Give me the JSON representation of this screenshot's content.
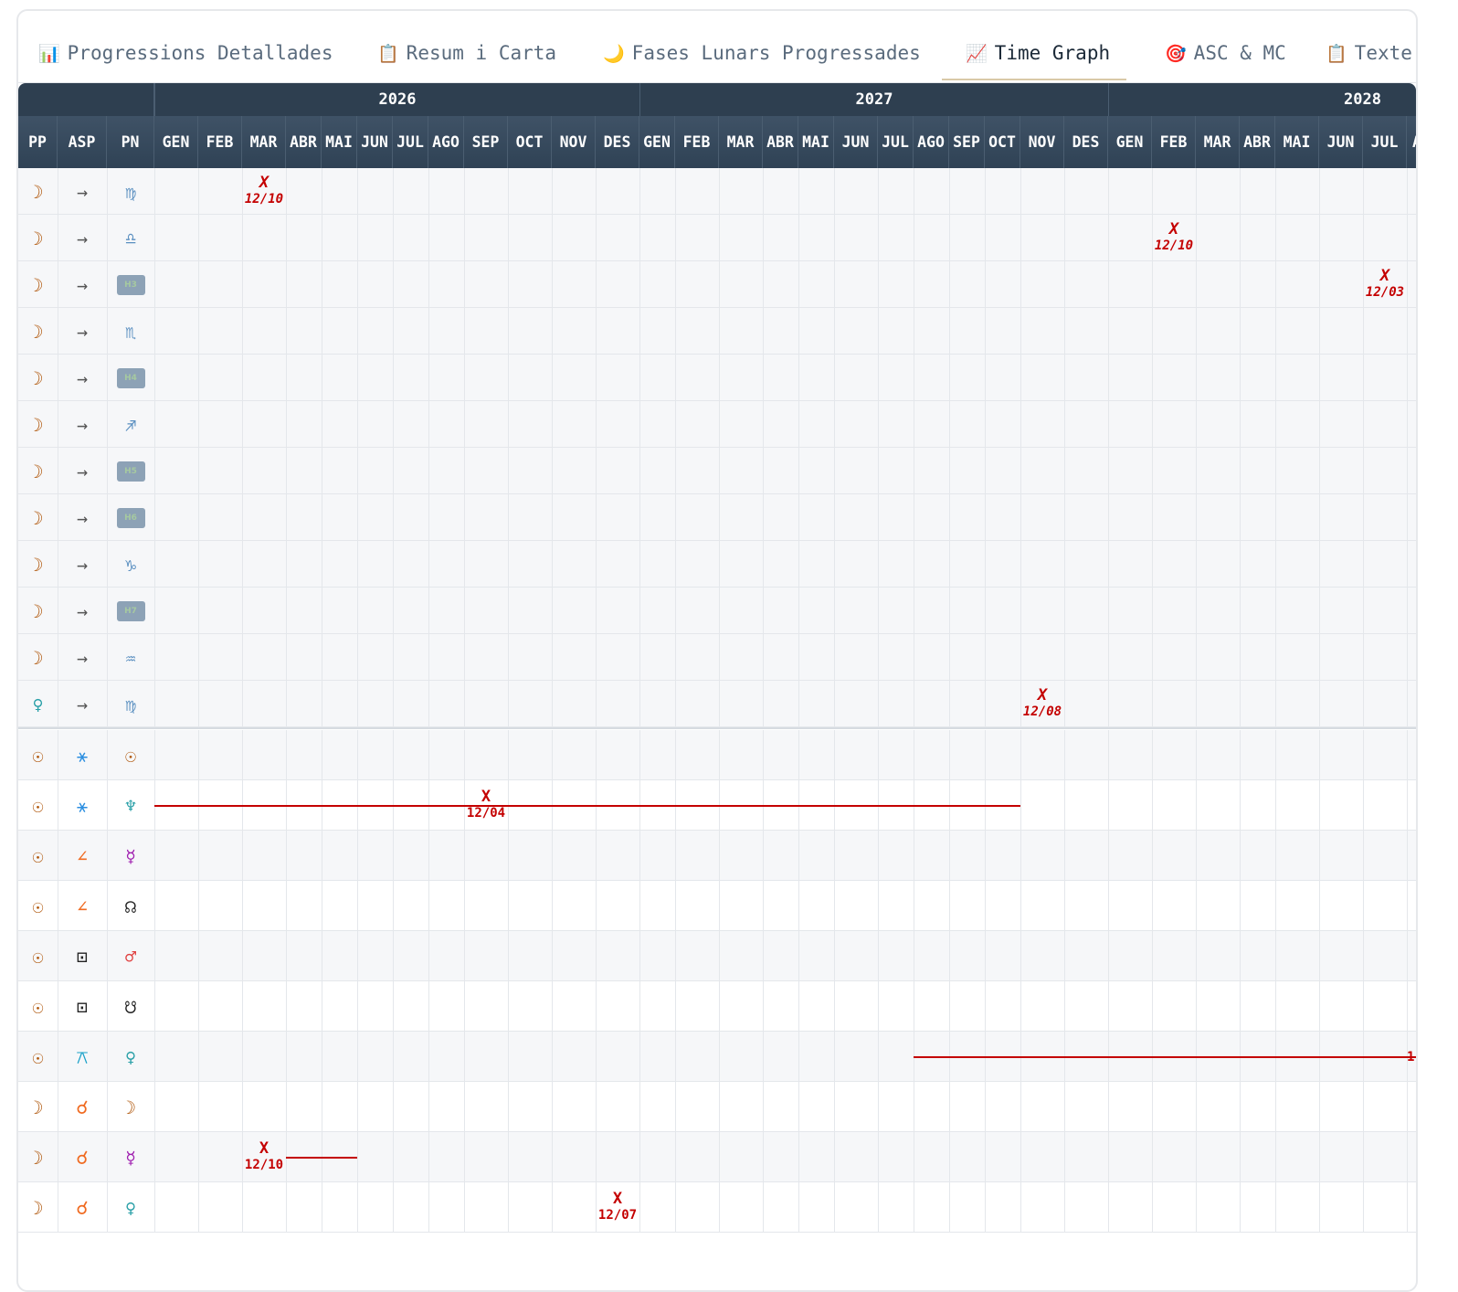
{
  "tabs": [
    {
      "icon": "📊",
      "label": "Progressions Detallades"
    },
    {
      "icon": "📋",
      "label": "Resum i Carta"
    },
    {
      "icon": "🌙",
      "label": "Fases Lunars Progressades"
    },
    {
      "icon": "📈",
      "label": "Time Graph",
      "active": true
    },
    {
      "icon": "🎯",
      "label": "ASC & MC"
    },
    {
      "icon": "📋",
      "label": "Texte"
    }
  ],
  "header": {
    "col_pp": "PP",
    "col_asp": "ASP",
    "col_pn": "PN",
    "years": [
      "2026",
      "2027",
      "2028"
    ],
    "months": [
      "GEN",
      "FEB",
      "MAR",
      "ABR",
      "MAI",
      "JUN",
      "JUL",
      "AGO",
      "SEP",
      "OCT",
      "NOV",
      "DES",
      "GEN",
      "FEB",
      "MAR",
      "ABR",
      "MAI",
      "JUN",
      "JUL",
      "AGO",
      "SEP",
      "OCT",
      "NOV",
      "DES",
      "GEN",
      "FEB",
      "MAR",
      "ABR",
      "MAI",
      "JUN",
      "JUL",
      "A"
    ]
  },
  "ingress_rows": [
    {
      "pp": "☽",
      "pp_color": "#b0570b",
      "asp": "→",
      "pn": "♍",
      "pn_color": "#5a8fc0",
      "marks": [
        {
          "month": 2,
          "x": "X",
          "date": "12/10"
        }
      ]
    },
    {
      "pp": "☽",
      "pp_color": "#b0570b",
      "asp": "→",
      "pn": "♎",
      "pn_color": "#5a8fc0",
      "marks": [
        {
          "month": 25,
          "x": "X",
          "date": "12/10"
        }
      ]
    },
    {
      "pp": "☽",
      "pp_color": "#b0570b",
      "asp": "→",
      "pn": "H3",
      "badge": true,
      "marks": [
        {
          "month": 30,
          "x": "X",
          "date": "12/03"
        }
      ]
    },
    {
      "pp": "☽",
      "pp_color": "#b0570b",
      "asp": "→",
      "pn": "♏",
      "pn_color": "#5a8fc0",
      "marks": []
    },
    {
      "pp": "☽",
      "pp_color": "#b0570b",
      "asp": "→",
      "pn": "H4",
      "badge": true,
      "marks": []
    },
    {
      "pp": "☽",
      "pp_color": "#b0570b",
      "asp": "→",
      "pn": "♐",
      "pn_color": "#5a8fc0",
      "marks": []
    },
    {
      "pp": "☽",
      "pp_color": "#b0570b",
      "asp": "→",
      "pn": "H5",
      "badge": true,
      "marks": []
    },
    {
      "pp": "☽",
      "pp_color": "#b0570b",
      "asp": "→",
      "pn": "H6",
      "badge": true,
      "marks": []
    },
    {
      "pp": "☽",
      "pp_color": "#b0570b",
      "asp": "→",
      "pn": "♑",
      "pn_color": "#5a8fc0",
      "marks": []
    },
    {
      "pp": "☽",
      "pp_color": "#b0570b",
      "asp": "→",
      "pn": "H7",
      "badge": true,
      "marks": []
    },
    {
      "pp": "☽",
      "pp_color": "#b0570b",
      "asp": "→",
      "pn": "♒",
      "pn_color": "#5a8fc0",
      "marks": []
    },
    {
      "pp": "♀",
      "pp_color": "#2aa0a8",
      "asp": "→",
      "pn": "♍",
      "pn_color": "#5a8fc0",
      "marks": [
        {
          "month": 22,
          "x": "X",
          "date": "12/08"
        }
      ]
    }
  ],
  "aspect_rows": [
    {
      "pp": "☉",
      "pp_color": "#b0570b",
      "asp": "⚹",
      "asp_color": "#2a8ee0",
      "pn": "☉",
      "pn_color": "#b0570b",
      "marks": [],
      "lines": []
    },
    {
      "pp": "☉",
      "pp_color": "#b0570b",
      "asp": "⚹",
      "asp_color": "#2a8ee0",
      "pn": "♆",
      "pn_color": "#2aa0a8",
      "marks": [
        {
          "month": 8,
          "x": "X",
          "date": "12/04"
        }
      ],
      "lines": [
        {
          "from": 0,
          "to": 8
        },
        {
          "from": 9,
          "to": 21
        }
      ]
    },
    {
      "pp": "☉",
      "pp_color": "#b0570b",
      "asp": "∠",
      "asp_color": "#f06a20",
      "pn": "☿",
      "pn_color": "#a020b0",
      "marks": [],
      "lines": []
    },
    {
      "pp": "☉",
      "pp_color": "#b0570b",
      "asp": "∠",
      "asp_color": "#f06a20",
      "pn": "☊",
      "pn_color": "#222222",
      "marks": [],
      "lines": []
    },
    {
      "pp": "☉",
      "pp_color": "#b0570b",
      "asp": "⊡",
      "asp_color": "#222222",
      "pn": "♂",
      "pn_color": "#e04040",
      "marks": [],
      "lines": []
    },
    {
      "pp": "☉",
      "pp_color": "#b0570b",
      "asp": "⊡",
      "asp_color": "#222222",
      "pn": "☋",
      "pn_color": "#222222",
      "marks": [],
      "lines": []
    },
    {
      "pp": "☉",
      "pp_color": "#b0570b",
      "asp": "⚻",
      "asp_color": "#18a0c8",
      "pn": "♀",
      "pn_color": "#2aa0a8",
      "marks": [
        {
          "month": 31,
          "x": "",
          "date": "1"
        }
      ],
      "lines": [
        {
          "from": 19,
          "to": 31
        }
      ]
    },
    {
      "pp": "☽",
      "pp_color": "#b0570b",
      "asp": "☌",
      "asp_color": "#f06a20",
      "pn": "☽",
      "pn_color": "#b0570b",
      "marks": [],
      "lines": []
    },
    {
      "pp": "☽",
      "pp_color": "#b0570b",
      "asp": "☌",
      "asp_color": "#f06a20",
      "pn": "☿",
      "pn_color": "#a020b0",
      "marks": [
        {
          "month": 2,
          "x": "X",
          "date": "12/10"
        }
      ],
      "lines": [
        {
          "from": 3,
          "to": 4
        }
      ]
    },
    {
      "pp": "☽",
      "pp_color": "#b0570b",
      "asp": "☌",
      "asp_color": "#f06a20",
      "pn": "♀",
      "pn_color": "#2aa0a8",
      "marks": [
        {
          "month": 11,
          "x": "X",
          "date": "12/07"
        }
      ],
      "lines": []
    }
  ]
}
